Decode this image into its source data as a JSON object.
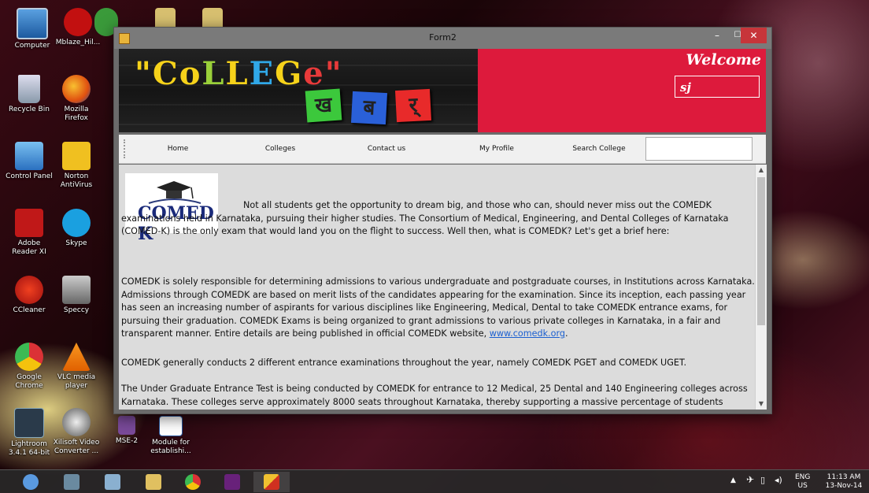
{
  "desktop": {
    "icons": [
      {
        "label": "Computer"
      },
      {
        "label": "Mblaze_Hil..."
      },
      {
        "label": "Recycle Bin"
      },
      {
        "label": "Mozilla Firefox"
      },
      {
        "label": "Control Panel"
      },
      {
        "label": "Norton AntiVirus"
      },
      {
        "label": "Adobe Reader XI"
      },
      {
        "label": "Skype"
      },
      {
        "label": "CCleaner"
      },
      {
        "label": "Speccy"
      },
      {
        "label": "Google Chrome"
      },
      {
        "label": "VLC media player"
      },
      {
        "label": "Lightroom 3.4.1 64-bit"
      },
      {
        "label": "Xilisoft Video Converter ..."
      },
      {
        "label": "MSE-2"
      },
      {
        "label": "Module for establishi..."
      }
    ]
  },
  "window": {
    "title": "Form2",
    "min_glyph": "–",
    "max_glyph": "☐",
    "close_glyph": "✕"
  },
  "banner": {
    "college_text": "\"CoLLEGe\"",
    "hindi_letters": [
      "ख",
      "ब",
      "र्"
    ],
    "welcome": "Welcome",
    "username": "sj",
    "accent_color": "#dd1a3c"
  },
  "menu": {
    "items": [
      "Home",
      "Colleges",
      "Contact us",
      "My Profile",
      "Search College"
    ],
    "search_value": ""
  },
  "content": {
    "logo_text": "COMED K",
    "p1": "Not all students get the opportunity to dream big, and those who can, should never miss out the COMEDK examinations held in Karnataka, pursuing their higher studies. The Consortium of Medical, Engineering, and Dental Colleges of Karnataka (COMED-K) is the only exam that would land you on the flight to success. Well then, what is COMEDK? Let's get a brief here:",
    "p2": "COMEDK is solely responsible for determining admissions to various undergraduate and postgraduate courses, in Institutions across Karnataka. Admissions through COMEDK are based on merit lists of the candidates appearing for the examination. Since its inception, each passing year has seen an increasing number of aspirants for various disciplines like Engineering, Medical, Dental to take COMEDK entrance exams, for pursuing their graduation. COMEDK Exams is being organized to grant admissions to various private colleges in Karnataka, in a fair and transparent manner. Entire details are being published in official COMEDK website, ",
    "link": "www.comedk.org",
    "p2_end": ".",
    "p3": "COMEDK generally conducts 2 different entrance examinations throughout the year, namely COMEDK PGET and COMEDK UGET.",
    "p4": "The Under Graduate Entrance Test is being conducted by COMEDK for entrance to 12 Medical, 25 Dental and 140 Engineering colleges across Karnataka. These colleges serve approximately 8000 seats throughout Karnataka, thereby supporting a massive percentage of students aspiring"
  },
  "taskbar": {
    "lang": "ENG",
    "region": "US",
    "time": "11:13 AM",
    "date": "13-Nov-14"
  }
}
